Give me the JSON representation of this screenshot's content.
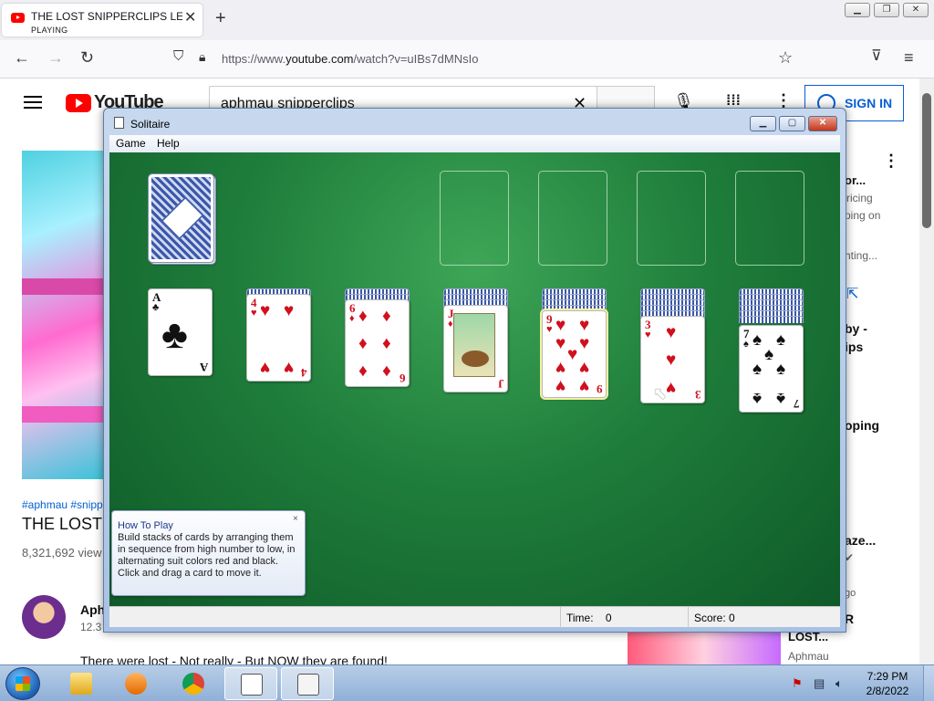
{
  "browser": {
    "tab_title": "THE LOST SNIPPERCLIPS LEVEL",
    "tab_status": "PLAYING",
    "url_prefix": "https://www.",
    "url_host": "youtube.com",
    "url_path": "/watch?v=uIBs7dMNsIo"
  },
  "youtube": {
    "logo": "YouTube",
    "search_query": "aphmau snipperclips",
    "sign_in": "SIGN IN",
    "hashtags": "#aphmau #snipp",
    "video_title": "THE LOST S",
    "views": "8,321,692 view",
    "channel_name": "Aph",
    "channel_subs": "12.3",
    "description": "There were lost - Not really - But NOW they are found!",
    "side_texts": [
      "or...",
      "ricing",
      "ping on",
      "hting...",
      "by -",
      "ips",
      "oping",
      "aze...",
      "go",
      "R",
      "LOST...",
      "Aphmau"
    ]
  },
  "solitaire": {
    "title": "Solitaire",
    "menu": [
      "Game",
      "Help"
    ],
    "status": {
      "time_label": "Time:",
      "time_value": "0",
      "score_label": "Score:",
      "score_value": "0"
    },
    "howto": {
      "title": "How To Play",
      "body": "Build stacks of cards by arranging them in sequence from high number to low, in alternating suit colors red and black. Click and drag a card to move it.",
      "close": "×"
    },
    "tableau": [
      {
        "rank": "A",
        "suit": "♣",
        "color": "black",
        "hidden": 0
      },
      {
        "rank": "4",
        "suit": "♥",
        "color": "red",
        "hidden": 1
      },
      {
        "rank": "6",
        "suit": "♦",
        "color": "red",
        "hidden": 2
      },
      {
        "rank": "J",
        "suit": "♦",
        "color": "red",
        "hidden": 3
      },
      {
        "rank": "9",
        "suit": "♥",
        "color": "red",
        "hidden": 4
      },
      {
        "rank": "3",
        "suit": "♥",
        "color": "red",
        "hidden": 5
      },
      {
        "rank": "7",
        "suit": "♠",
        "color": "black",
        "hidden": 6
      }
    ],
    "foundation_slots": 4,
    "colors": {
      "felt": "#1f7e3b",
      "red_suit": "#d0101e",
      "card_back": "#3b57a8"
    }
  },
  "taskbar": {
    "time": "7:29 PM",
    "date": "2/8/2022",
    "apps": [
      "explorer",
      "media-player",
      "chrome",
      "notepad",
      "solitaire"
    ]
  },
  "icons": [
    "youtube-favicon",
    "close-icon",
    "plus-icon",
    "back-icon",
    "forward-icon",
    "reload-icon",
    "shield-icon",
    "lock-icon",
    "star-icon",
    "pocket-icon",
    "menu-icon",
    "search-icon",
    "mic-icon",
    "apps-icon",
    "more-icon",
    "person-icon",
    "windows-start-icon",
    "volume-icon",
    "network-icon",
    "flag-icon"
  ]
}
